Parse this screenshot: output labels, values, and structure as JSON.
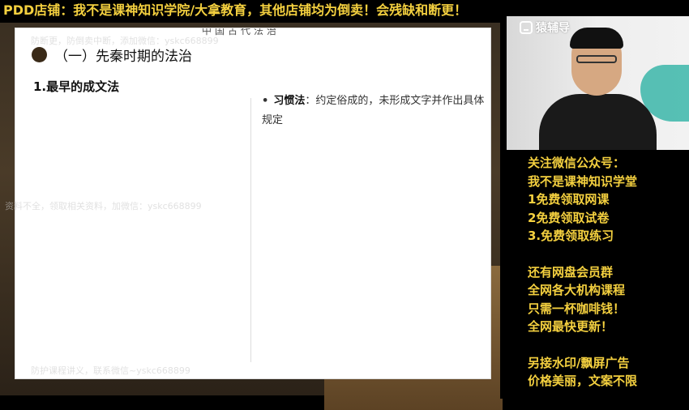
{
  "banner": {
    "text": "PDD店铺：我不是课神知识学院/大拿教育，其他店铺均为倒卖！会残缺和断更！"
  },
  "slide": {
    "header_strip": "中国古代法治",
    "section_title": "（一）先秦时期的法治",
    "sub_title": "1.最早的成文法",
    "definition": {
      "bullet": "•",
      "term": "习惯法",
      "text": "：约定俗成的，未形成文字并作出具体规定"
    }
  },
  "watermarks": {
    "top": "防断更，防倒卖中断，添加微信：yskc668899",
    "middle": "资料不全，领取相关资料，加微信：yskc668899",
    "bottom": "防护课程讲义，联系微信~yskc668899"
  },
  "video": {
    "logo_text": "猿辅导"
  },
  "promo": {
    "lines_group1": [
      "关注微信公众号：",
      "我不是课神知识学堂",
      "1免费领取网课",
      "2免费领取试卷",
      "3.免费领取练习"
    ],
    "lines_group2": [
      "还有网盘会员群",
      "全网各大机构课程",
      "只需一杯咖啡钱！",
      "全网最快更新！"
    ],
    "lines_group3": [
      "另接水印/飘屏广告",
      "价格美丽，文案不限"
    ]
  },
  "colors": {
    "banner_text": "#f4d03f",
    "promo_text": "#f4d03f",
    "slide_bg": "#ffffff"
  }
}
